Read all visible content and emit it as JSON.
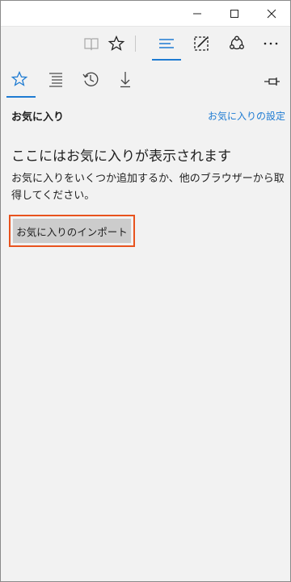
{
  "window": {
    "minimize_icon": "minimize-icon",
    "maximize_icon": "maximize-icon",
    "close_icon": "close-icon"
  },
  "toolbar": {
    "icons": [
      "reading-view-icon",
      "favorite-star-icon",
      "hub-icon",
      "web-note-icon",
      "share-icon",
      "more-icon"
    ],
    "accent": "#1e7bd2"
  },
  "hub": {
    "tabs": [
      "favorites-icon",
      "reading-list-icon",
      "history-icon",
      "downloads-icon"
    ],
    "pin_icon": "pin-icon"
  },
  "favorites": {
    "title": "お気に入り",
    "settings_link": "お気に入りの設定",
    "empty_heading": "ここにはお気に入りが表示されます",
    "empty_description": "お気に入りをいくつか追加するか、他のブラウザーから取得してください。",
    "import_button": "お気に入りのインポート",
    "highlight_color": "#e8531e"
  }
}
